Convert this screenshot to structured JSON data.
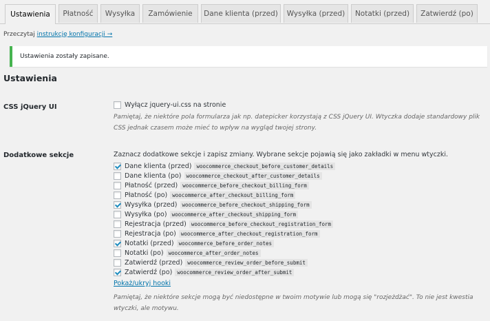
{
  "tabs": [
    {
      "label": "Ustawienia",
      "active": true
    },
    {
      "label": "Płatność"
    },
    {
      "label": "Wysyłka"
    },
    {
      "label": "Zamówienie"
    },
    {
      "label": "Dane klienta (przed)"
    },
    {
      "label": "Wysyłka (przed)"
    },
    {
      "label": "Notatki (przed)"
    },
    {
      "label": "Zatwierdź (po)"
    }
  ],
  "instruction": {
    "prefix": "Przeczytaj ",
    "link": "instrukcję konfiguracji →"
  },
  "notice": "Ustawienia zostały zapisane.",
  "section_title": "Ustawienia",
  "css_row": {
    "label": "CSS jQuery UI",
    "checkbox_label": "Wyłącz jquery-ui.css na stronie",
    "checked": false,
    "desc_line1": "Pamiętaj, że niektóre pola formularza jak np. datepicker korzystają z CSS jQuery UI. Wtyczka dodaje standardowy plik",
    "desc_line2": "CSS jednak czasem może mieć to wpływ na wygląd twojej strony."
  },
  "sections_row": {
    "label": "Dodatkowe sekcje",
    "intro": "Zaznacz dodatkowe sekcje i zapisz zmiany. Wybrane sekcje pojawią się jako zakładki w menu wtyczki.",
    "items": [
      {
        "label": "Dane klienta (przed)",
        "hook": "woocommerce_checkout_before_customer_details",
        "checked": true
      },
      {
        "label": "Dane klienta (po)",
        "hook": "woocommerce_checkout_after_customer_details",
        "checked": false
      },
      {
        "label": "Płatność (przed)",
        "hook": "woocommerce_before_checkout_billing_form",
        "checked": false
      },
      {
        "label": "Płatność (po)",
        "hook": "woocommerce_after_checkout_billing_form",
        "checked": false
      },
      {
        "label": "Wysyłka (przed)",
        "hook": "woocommerce_before_checkout_shipping_form",
        "checked": true
      },
      {
        "label": "Wysyłka (po)",
        "hook": "woocommerce_after_checkout_shipping_form",
        "checked": false
      },
      {
        "label": "Rejestracja (przed)",
        "hook": "woocommerce_before_checkout_registration_form",
        "checked": false
      },
      {
        "label": "Rejestracja (po)",
        "hook": "woocommerce_after_checkout_registration_form",
        "checked": false
      },
      {
        "label": "Notatki (przed)",
        "hook": "woocommerce_before_order_notes",
        "checked": true
      },
      {
        "label": "Notatki (po)",
        "hook": "woocommerce_after_order_notes",
        "checked": false
      },
      {
        "label": "Zatwierdź (przed)",
        "hook": "woocommerce_review_order_before_submit",
        "checked": false
      },
      {
        "label": "Zatwierdź (po)",
        "hook": "woocommerce_review_order_after_submit",
        "checked": true
      }
    ],
    "toggle_link": "Pokaż/ukryj hooki",
    "desc_line1": "Pamiętaj, że niektóre sekcje mogą być niedostępne w twoim motywie lub mogą się \"rozjeżdżać\". To nie jest kwestia",
    "desc_line2": "wtyczki, ale motywu."
  },
  "colors": {
    "link": "#0073aa",
    "notice_border": "#46b450",
    "check": "#1e8cbe"
  }
}
